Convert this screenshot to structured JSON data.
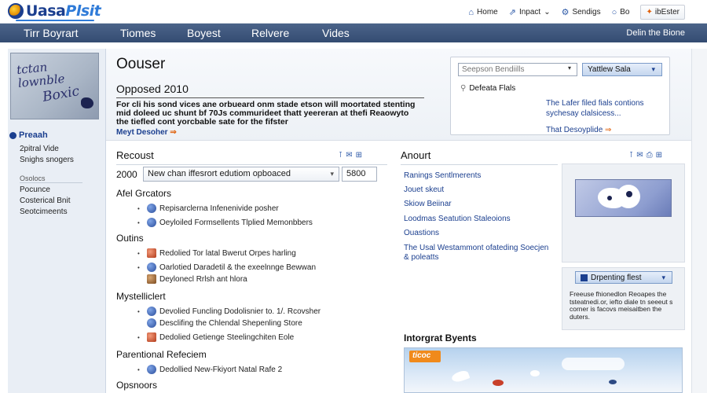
{
  "topbar": {
    "logo_main": "Uasa",
    "logo_accent": "Plsit",
    "links": [
      {
        "icon": "home-icon",
        "label": "Home",
        "glyph": "⌂"
      },
      {
        "icon": "impact-icon",
        "label": "Inpact",
        "glyph": "⇗"
      },
      {
        "icon": "settings-icon",
        "label": "Sendigs",
        "glyph": "⚙"
      },
      {
        "icon": "circle-icon",
        "label": "Bo",
        "glyph": "○"
      }
    ],
    "login_label": "ibEster"
  },
  "nav": {
    "items": [
      "Tirr  Boyrart",
      "Tiomes",
      "Boyest",
      "Relvere",
      "Vides"
    ],
    "right_label": "Delin the Bione"
  },
  "sidebar": {
    "image_text_line1": "tctan",
    "image_text_line2": "lownble",
    "image_text_line3": "Boxic",
    "heading": "Preaah",
    "links": [
      "2pitral Vide",
      "Snighs snogers"
    ],
    "sub_label": "Osolocs",
    "links2": [
      "Pocunce",
      "Costerical Bnit",
      "Seotcimeents"
    ]
  },
  "hero": {
    "title": "Oouser",
    "subtitle": "Opposed 2010",
    "body": "For cli his sond vices ane orbueard onm stade etson will moortated stenting mid doleed uc shunt bf 70Js commurideet thatt yeereran at thefi Reaowyto the tiefled cont yorcbable sate for the fifster",
    "more_label": "Meyt Desoher",
    "more_glyph": "⇒"
  },
  "search": {
    "placeholder": "Seepson Bendiills",
    "button_label": "Yattlew Sala",
    "refine_label": "Defeata Flals",
    "links": [
      {
        "text": "The Lafer filed fials contions sychesay clalsicess...",
        "glyph": ""
      },
      {
        "text": "That Desoyplide",
        "glyph": "⇒"
      }
    ]
  },
  "recent": {
    "title": "Recoust",
    "year": "2000",
    "filter_value": "New chan iffesrort edutiom opboaced",
    "filter_num": "5800",
    "sections": [
      {
        "title": "Afel Grcators",
        "items": [
          "Repisarclerna Infenenivide posher",
          "Oeyloiled Formsellents Tlplied Memonbbers"
        ]
      },
      {
        "title": "Outins",
        "items": [
          "Redolied Tor latal Bwerut Orpes harling",
          "Oarlotied Daradetil & the exeelnnge Bewwan",
          "Deylonecl Rrlsh ant hlora"
        ]
      },
      {
        "title": "Mystelliclert",
        "items": [
          "Devolied Funcling Dodolisnier to. 1/. Rcovsher",
          "Desclifing the Chlendal Shepenling Store",
          "Dedolied Getienge Steelingchiten Eole"
        ]
      },
      {
        "title": "Parentional Refeciem",
        "items": [
          "Dedollied New-Fkiyort Natal Rafe 2"
        ]
      },
      {
        "title": "Opsnoors",
        "items": []
      }
    ]
  },
  "about": {
    "title": "Anourt",
    "links": [
      "Ranings Sentlmerents",
      "Jouet skeut",
      "Skiow Beiinar",
      "Loodmas Seatution Staleoions",
      "Ouastions",
      "The Usal Westammont ofateding Soecjen & poleatts"
    ]
  },
  "promo": {
    "button_label": "Drpenting flest",
    "text": "Freeuse fhionedlon Reoapes the tsteatnedi.or, iefto diale tn seeeut s corner is facovs meisaitben the duters."
  },
  "events": {
    "title": "Intorgrat Byents",
    "tag": "ticoc"
  }
}
